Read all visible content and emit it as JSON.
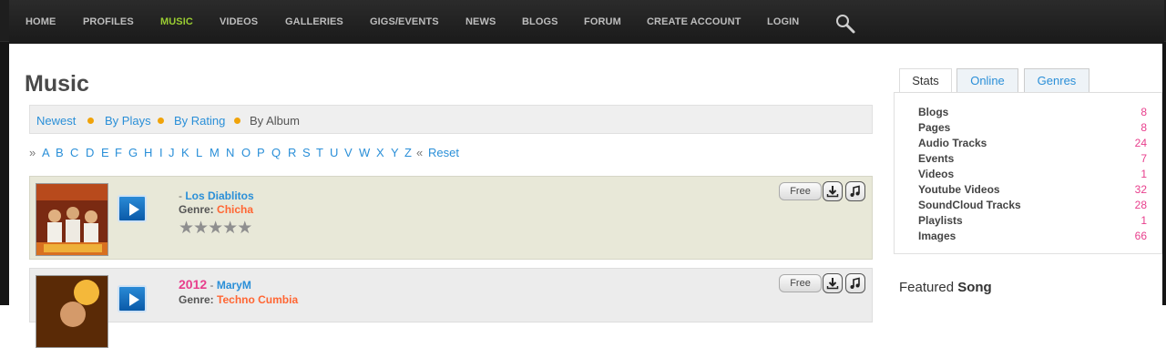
{
  "nav": {
    "items": [
      "HOME",
      "PROFILES",
      "MUSIC",
      "VIDEOS",
      "GALLERIES",
      "GIGS/EVENTS",
      "NEWS",
      "BLOGS",
      "FORUM",
      "CREATE ACCOUNT",
      "LOGIN"
    ],
    "active": "MUSIC",
    "search_icon": "search-icon"
  },
  "page": {
    "title": "Music"
  },
  "sort": {
    "options": [
      "Newest",
      "By Plays",
      "By Rating",
      "By Album"
    ],
    "current": "By Album"
  },
  "alphabet": {
    "prefix": "»",
    "letters": [
      "A",
      "B",
      "C",
      "D",
      "E",
      "F",
      "G",
      "H",
      "I",
      "J",
      "K",
      "L",
      "M",
      "N",
      "O",
      "P",
      "Q",
      "R",
      "S",
      "T",
      "U",
      "V",
      "W",
      "X",
      "Y",
      "Z"
    ],
    "reset_prefix": "«",
    "reset": "Reset"
  },
  "tracks": [
    {
      "title": "",
      "separator": " - ",
      "artist": "Los Diablitos",
      "genre_label": "Genre:",
      "genre": "Chicha",
      "price": "Free",
      "rating_stars": 5
    },
    {
      "title": "2012",
      "separator": " - ",
      "artist": "MaryM",
      "genre_label": "Genre:",
      "genre": "Techno Cumbia",
      "price": "Free"
    }
  ],
  "sidebar": {
    "tabs": [
      "Stats",
      "Online",
      "Genres"
    ],
    "active_tab": "Stats",
    "stats": [
      {
        "label": "Blogs",
        "value": "8"
      },
      {
        "label": "Pages",
        "value": "8"
      },
      {
        "label": "Audio Tracks",
        "value": "24"
      },
      {
        "label": "Events",
        "value": "7"
      },
      {
        "label": "Videos",
        "value": "1"
      },
      {
        "label": "Youtube Videos",
        "value": "32"
      },
      {
        "label": "SoundCloud Tracks",
        "value": "28"
      },
      {
        "label": "Playlists",
        "value": "1"
      },
      {
        "label": "Images",
        "value": "66"
      }
    ],
    "featured_prefix": "Featured",
    "featured_word": "Song"
  },
  "colors": {
    "nav_bg": "#1e1e1e",
    "nav_active": "#9acd32",
    "link": "#2a8fd8",
    "accent_pink": "#e83e8c",
    "genre_orange": "#ff6633",
    "sort_dot": "#f0a30a"
  }
}
